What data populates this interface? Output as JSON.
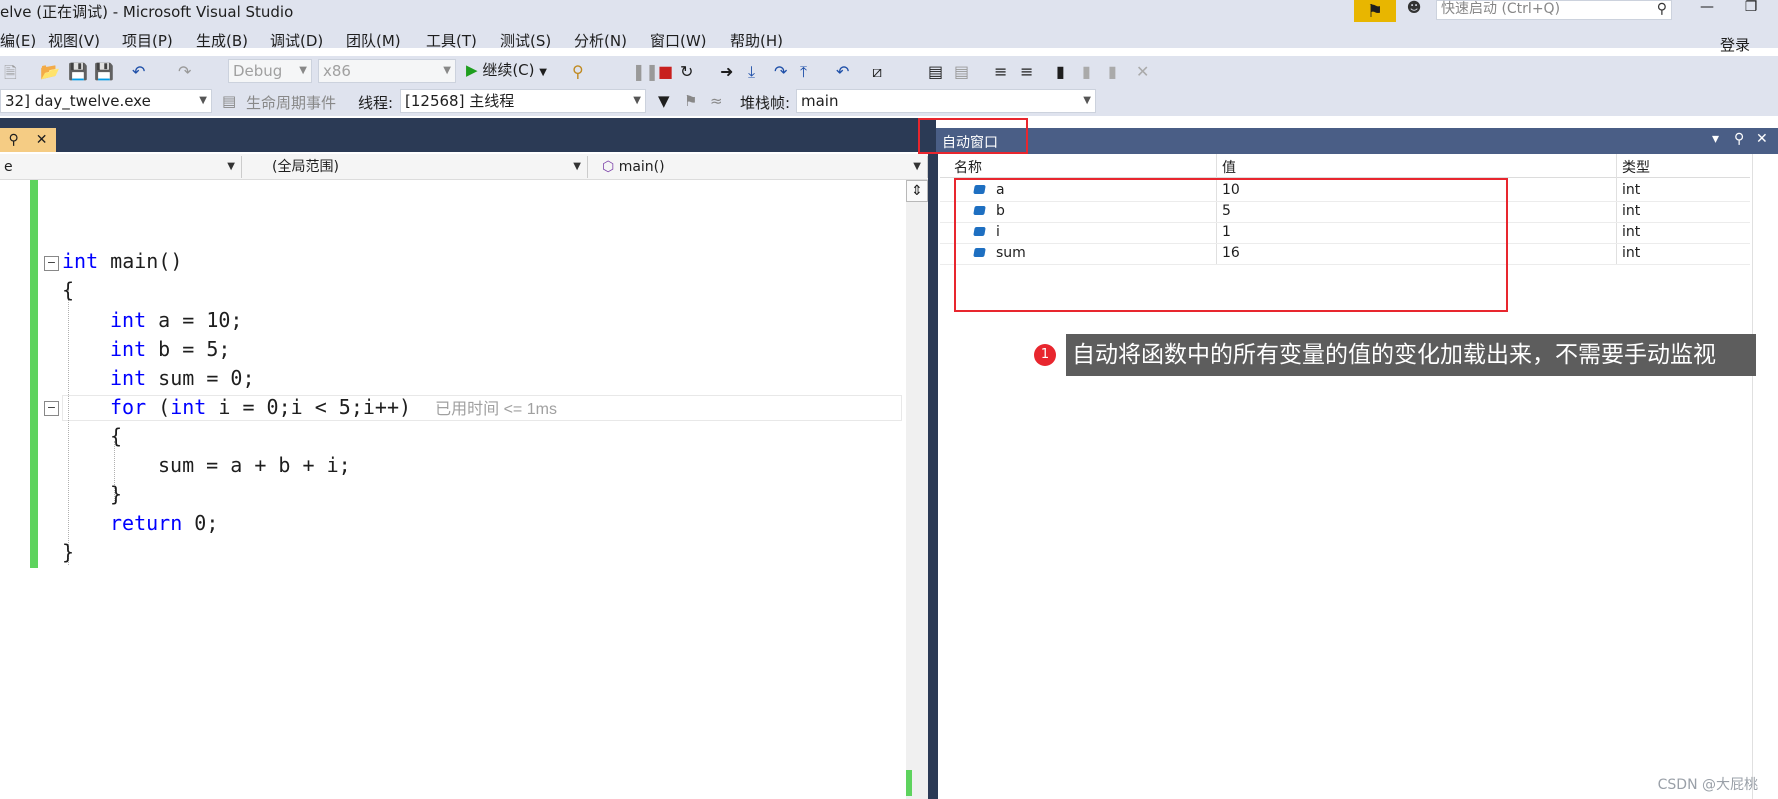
{
  "window": {
    "title": "elve (正在调试) - Microsoft Visual Studio",
    "quick_launch_placeholder": "快速启动 (Ctrl+Q)",
    "login": "登录"
  },
  "menu": [
    "编(E)",
    "视图(V)",
    "项目(P)",
    "生成(B)",
    "调试(D)",
    "团队(M)",
    "工具(T)",
    "测试(S)",
    "分析(N)",
    "窗口(W)",
    "帮助(H)"
  ],
  "toolbar": {
    "config": "Debug",
    "platform": "x86",
    "continue_label": "继续(C)"
  },
  "debug_toolbar": {
    "process": "32] day_twelve.exe",
    "lifecycle_label": "生命周期事件",
    "thread_label": "线程:",
    "thread_value": "[12568] 主线程",
    "stack_label": "堆栈帧:",
    "stack_value": "main"
  },
  "editor": {
    "nav_left": "e",
    "nav_scope": "(全局范围)",
    "nav_func": "main()",
    "perf_tip": "已用时间 <= 1ms",
    "lines": {
      "l1_kw": "int",
      "l1_rest": " main()",
      "l2": "{",
      "l3_kw": "int",
      "l3_rest": " a = 10;",
      "l4_kw": "int",
      "l4_rest": " b = 5;",
      "l5_kw": "int",
      "l5_rest": " sum = 0;",
      "l6_kw": "for",
      "l6_a": " (",
      "l6_kw2": "int",
      "l6_rest": " i = 0;i < 5;i++)",
      "l7": "{",
      "l8": "sum = a + b + i;",
      "l9": "}",
      "l10_kw": "return",
      "l10_rest": " 0;",
      "l11": "}"
    }
  },
  "autos": {
    "panel_title": "自动窗口",
    "headers": {
      "name": "名称",
      "value": "值",
      "type": "类型"
    },
    "rows": [
      {
        "name": "a",
        "value": "10",
        "type": "int"
      },
      {
        "name": "b",
        "value": "5",
        "type": "int"
      },
      {
        "name": "i",
        "value": "1",
        "type": "int"
      },
      {
        "name": "sum",
        "value": "16",
        "type": "int"
      }
    ]
  },
  "annotation": {
    "badge": "1",
    "text": "自动将函数中的所有变量的值的变化加载出来，不需要手动监视"
  },
  "watermark": "CSDN @大屁桃"
}
